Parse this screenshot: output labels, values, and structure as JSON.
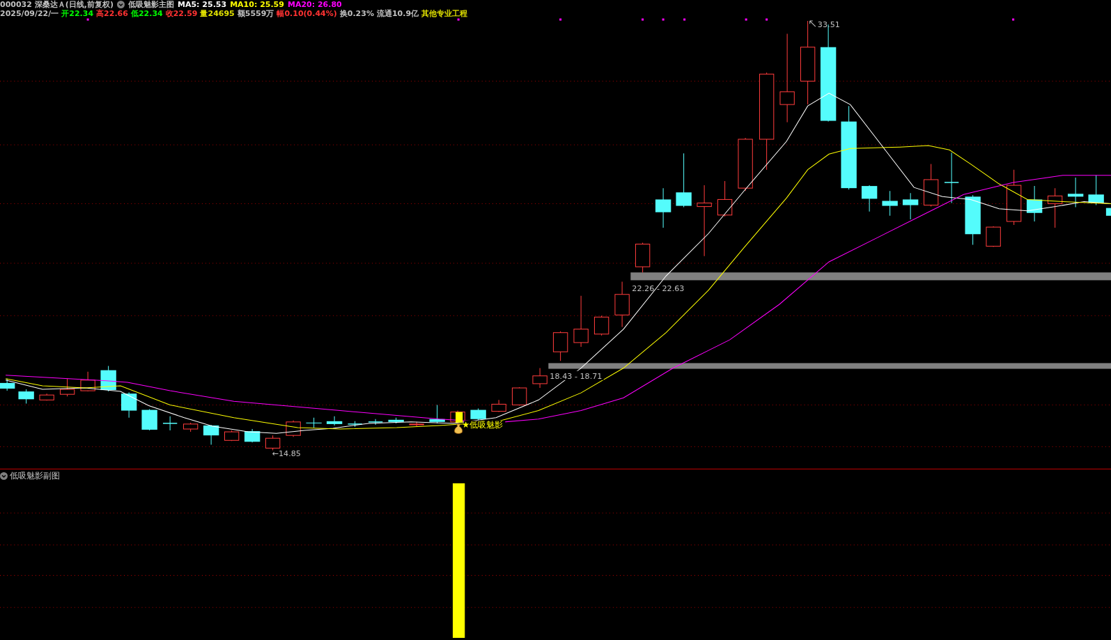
{
  "header": {
    "line1": [
      {
        "text": "000032 深桑达Ａ(日线,前复权)",
        "color": "#c0c0c0"
      },
      {
        "text": "低吸魅影主图",
        "color": "#c0c0c0",
        "kind": "indicator"
      },
      {
        "text": "MA5: 25.53",
        "color": "#ffffff"
      },
      {
        "text": "MA10: 25.59",
        "color": "#ffff00"
      },
      {
        "text": "MA20: 26.80",
        "color": "#ff00ff"
      }
    ],
    "line2": [
      {
        "text": "2025/09/22/一",
        "color": "#c0c0c0"
      },
      {
        "text": "开22.34",
        "color": "#00ff00"
      },
      {
        "text": "高22.66",
        "color": "#ff3232"
      },
      {
        "text": "低22.34",
        "color": "#00ff00"
      },
      {
        "text": "收22.59",
        "color": "#ff3232"
      },
      {
        "text": "量24695",
        "color": "#e0e000"
      },
      {
        "text": "额5559万",
        "color": "#c0c0c0"
      },
      {
        "text": "幅0.10(0.44%)",
        "color": "#ff3232"
      },
      {
        "text": "换0.23%",
        "color": "#c0c0c0"
      },
      {
        "text": "流通10.9亿",
        "color": "#c0c0c0"
      },
      {
        "text": "其他专业工程",
        "color": "#e0e000"
      }
    ]
  },
  "main_chart": {
    "price_marks": [
      "33.51",
      "←14.85"
    ],
    "zones": [
      "22.26 - 22.63",
      "18.43 - 18.71"
    ],
    "signal_label": "★低吸魅影"
  },
  "sub_chart": {
    "title": "低吸魅影副图"
  }
}
